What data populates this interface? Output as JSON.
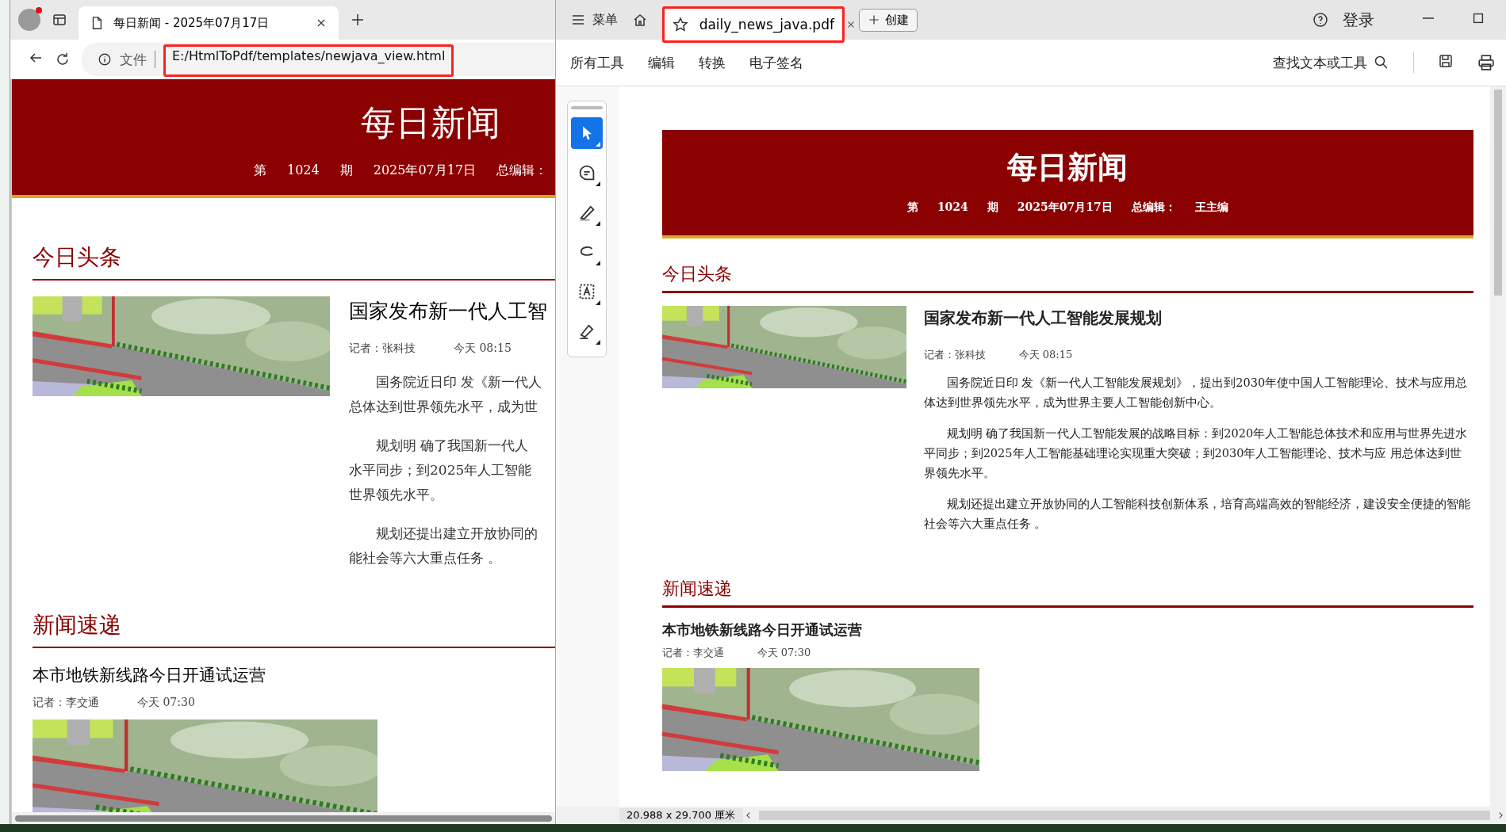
{
  "browser": {
    "tab": {
      "title": "每日新闻 - 2025年07月17日"
    },
    "address": {
      "label": "文件",
      "url": "E:/HtmlToPdf/templates/newjava_view.html",
      "annotated": true
    },
    "page": {
      "masthead": {
        "title": "每日新闻",
        "meta": [
          "第",
          "1024",
          "期",
          "2025年07月17日",
          "总编辑："
        ]
      },
      "sections": [
        {
          "heading": "今日头条",
          "articles": [
            {
              "kind": "feature",
              "title": "国家发布新一代人工智",
              "byline": "记者：张科技",
              "time": "今天 08:15",
              "paragraphs": [
                [
                  "国务院近日印 发《新一代人",
                  "总体达到世界领先水平，成为世"
                ],
                [
                  "规划明 确了我国新一代人",
                  "水平同步；到2025年人工智能",
                  "世界领先水平。"
                ],
                [
                  "规划还提出建立开放协同的",
                  "能社会等六大重点任务 。"
                ]
              ]
            }
          ]
        },
        {
          "heading": "新闻速递",
          "articles": [
            {
              "kind": "brief",
              "title": "本市地铁新线路今日开通试运营",
              "byline": "记者：李交通",
              "time": "今天 07:30"
            }
          ]
        }
      ]
    }
  },
  "pdf": {
    "menu": "菜单",
    "tab": {
      "title": "daily_news_java.pdf",
      "annotated": true
    },
    "create": "创建",
    "login": "登录",
    "toolbar": [
      "所有工具",
      "编辑",
      "转换",
      "电子签名"
    ],
    "search": "查找文本或工具",
    "tools": [
      {
        "kind": "select",
        "selected": true
      },
      {
        "kind": "comment",
        "selected": false
      },
      {
        "kind": "highlight",
        "selected": false
      },
      {
        "kind": "draw",
        "selected": false
      },
      {
        "kind": "textbox",
        "selected": false
      },
      {
        "kind": "sign",
        "selected": false
      }
    ],
    "document": {
      "masthead": {
        "title": "每日新闻",
        "meta": [
          "第",
          "1024",
          "期",
          "2025年07月17日",
          "总编辑：",
          "王主编"
        ]
      },
      "sections": [
        {
          "heading": "今日头条",
          "articles": [
            {
              "kind": "feature",
              "title": "国家发布新一代人工智能发展规划",
              "byline": "记者：张科技",
              "time": "今天 08:15",
              "paragraphs": [
                "国务院近日印 发《新一代人工智能发展规划》，提出到2030年使中国人工智能理论、技术与应用总体达到世界领先水平，成为世界主要人工智能创新中心。",
                "规划明 确了我国新一代人工智能发展的战略目标：到2020年人工智能总体技术和应用与世界先进水平同步；到2025年人工智能基础理论实现重大突破；到2030年人工智能理论、技术与应 用总体达到世界领先水平。",
                "规划还提出建立开放协同的人工智能科技创新体系，培育高端高效的智能经济，建设安全便捷的智能社会等六大重点任务 。"
              ]
            }
          ]
        },
        {
          "heading": "新闻速递",
          "articles": [
            {
              "kind": "brief",
              "title": "本市地铁新线路今日开通试运营",
              "byline": "记者：李交通",
              "time": "今天 07:30"
            }
          ]
        }
      ]
    },
    "page_size": "20.988 x 29.700 厘米"
  }
}
